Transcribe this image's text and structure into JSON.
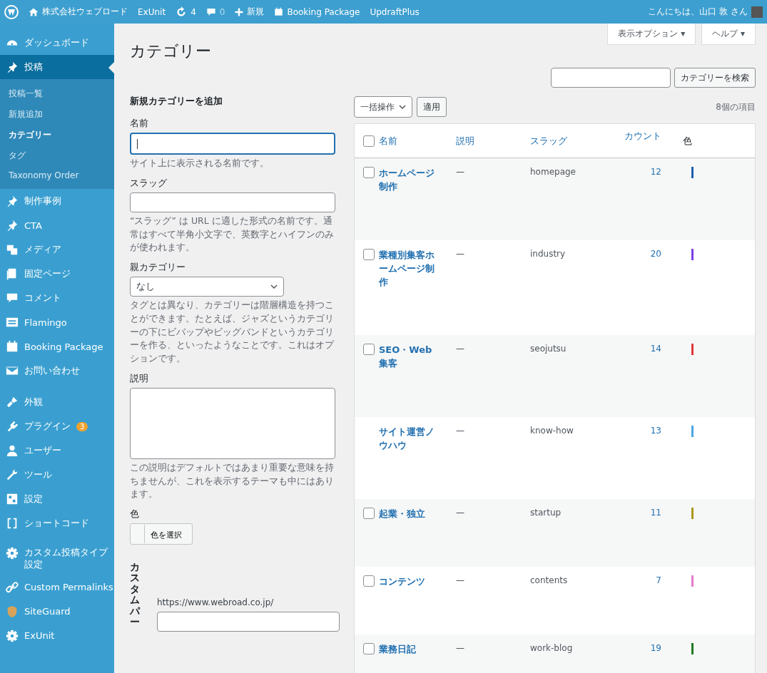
{
  "admin_bar": {
    "site": "株式会社ウェブロード",
    "exunit": "ExUnit",
    "updates": "4",
    "comments": "0",
    "new": "新規",
    "booking": "Booking Package",
    "updraft": "UpdraftPlus",
    "greeting": "こんにちは、山口 敦 さん"
  },
  "sidebar": {
    "groups": [
      [
        {
          "label": "ダッシュボード",
          "selected": false
        },
        {
          "label": "投稿",
          "selected": true,
          "children": [
            {
              "label": "投稿一覧",
              "selected": false
            },
            {
              "label": "新規追加",
              "selected": false
            },
            {
              "label": "カテゴリー",
              "selected": true
            },
            {
              "label": "タグ",
              "selected": false
            },
            {
              "label": "Taxonomy Order",
              "selected": false
            }
          ]
        },
        {
          "label": "制作事例",
          "selected": false
        },
        {
          "label": "CTA",
          "selected": false
        },
        {
          "label": "メディア",
          "selected": false
        },
        {
          "label": "固定ページ",
          "selected": false
        },
        {
          "label": "コメント",
          "selected": false
        },
        {
          "label": "Flamingo",
          "selected": false
        },
        {
          "label": "Booking Package",
          "selected": false
        },
        {
          "label": "お問い合わせ",
          "selected": false
        }
      ],
      [
        {
          "label": "外観",
          "selected": false
        },
        {
          "label": "プラグイン",
          "selected": false,
          "badge": "3"
        },
        {
          "label": "ユーザー",
          "selected": false
        },
        {
          "label": "ツール",
          "selected": false
        },
        {
          "label": "設定",
          "selected": false
        },
        {
          "label": "ショートコード",
          "selected": false
        }
      ],
      [
        {
          "label": "カスタム投稿タイプ設定",
          "selected": false
        },
        {
          "label": "Custom Permalinks",
          "selected": false
        },
        {
          "label": "SiteGuard",
          "selected": false
        },
        {
          "label": "ExUnit",
          "selected": false
        }
      ]
    ]
  },
  "header": {
    "title": "カテゴリー",
    "screen_options": "表示オプション ▾",
    "help": "ヘルプ ▾",
    "search_button": "カテゴリーを検索"
  },
  "form": {
    "heading": "新規カテゴリーを追加",
    "name": {
      "label": "名前",
      "hint": "サイト上に表示される名前です。"
    },
    "slug": {
      "label": "スラッグ",
      "hint": "“スラッグ” は URL に適した形式の名前です。通常はすべて半角小文字で、英数字とハイフンのみが使われます。"
    },
    "parent": {
      "label": "親カテゴリー",
      "value": "なし",
      "hint": "タグとは異なり、カテゴリーは階層構造を持つことができます。たとえば、ジャズというカテゴリーの下にビバップやビッグバンドというカテゴリーを作る、といったようなことです。これはオプションです。"
    },
    "description": {
      "label": "説明",
      "hint": "この説明はデフォルトではあまり重要な意味を持ちませんが、これを表示するテーマも中にはあります。"
    },
    "color": {
      "label": "色",
      "button": "色を選択"
    },
    "custom_field": {
      "label": "カスタムパー",
      "url": "https://www.webroad.co.jp/"
    }
  },
  "table": {
    "select_all_checked": false,
    "bulk_action": "一括操作",
    "apply": "適用",
    "count": "8個の項目",
    "columns": [
      "名前",
      "説明",
      "スラッグ",
      "カウント",
      "色"
    ],
    "rows": [
      {
        "name": "ホームページ制作",
        "description": "—",
        "slug": "homepage",
        "count": "12",
        "color": "#1f5fae",
        "kind": "checkbox",
        "checked": false
      },
      {
        "name": "業種別集客ホームページ制作",
        "description": "—",
        "slug": "industry",
        "count": "20",
        "color": "#7a3fe0",
        "kind": "checkbox",
        "checked": false
      },
      {
        "name": "SEO・Web集客",
        "description": "—",
        "slug": "seojutsu",
        "count": "14",
        "color": "#e0373a",
        "kind": "checkbox",
        "checked": false
      },
      {
        "name": "サイト運営ノウハウ",
        "description": "—",
        "slug": "know-how",
        "count": "13",
        "color": "#4aa6e0",
        "kind": "plain"
      },
      {
        "name": "起業・独立",
        "description": "—",
        "slug": "startup",
        "count": "11",
        "color": "#a8981c",
        "kind": "checkbox",
        "checked": false
      },
      {
        "name": "コンテンツ",
        "description": "—",
        "slug": "contents",
        "count": "7",
        "color": "#e27bc9",
        "kind": "checkbox",
        "checked": false
      },
      {
        "name": "業務日記",
        "description": "—",
        "slug": "work-blog",
        "count": "19",
        "color": "#1f7a26",
        "kind": "checkbox",
        "checked": false
      }
    ]
  }
}
